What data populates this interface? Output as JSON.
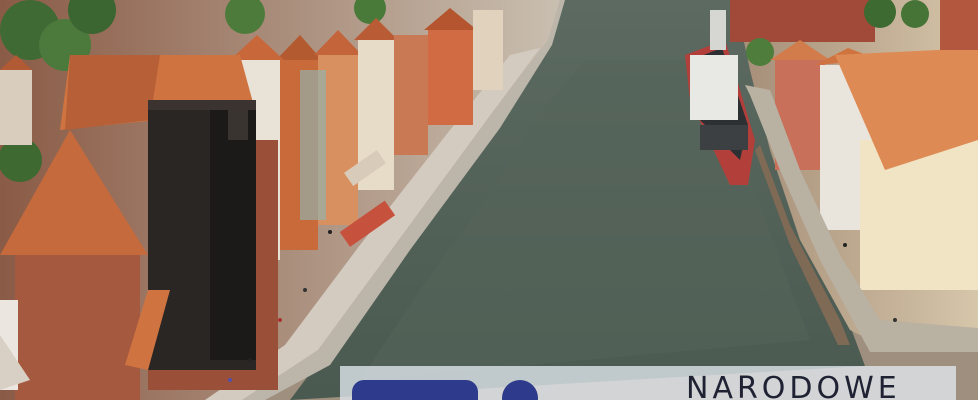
{
  "photo": {
    "subject": "aerial-city-river-view",
    "colors": {
      "river": "#4f5e52",
      "roof": "#c56a3c",
      "brick": "#a55a3f",
      "crane": "#2a2624",
      "quay": "#b9b4aa",
      "ship_hull": "#b23f3a"
    }
  },
  "overlay": {
    "brand_text": "NARODOWE",
    "colors": {
      "mark": "#2e3a8c",
      "panel": "#e2e8ee",
      "text": "#1f2233"
    }
  }
}
